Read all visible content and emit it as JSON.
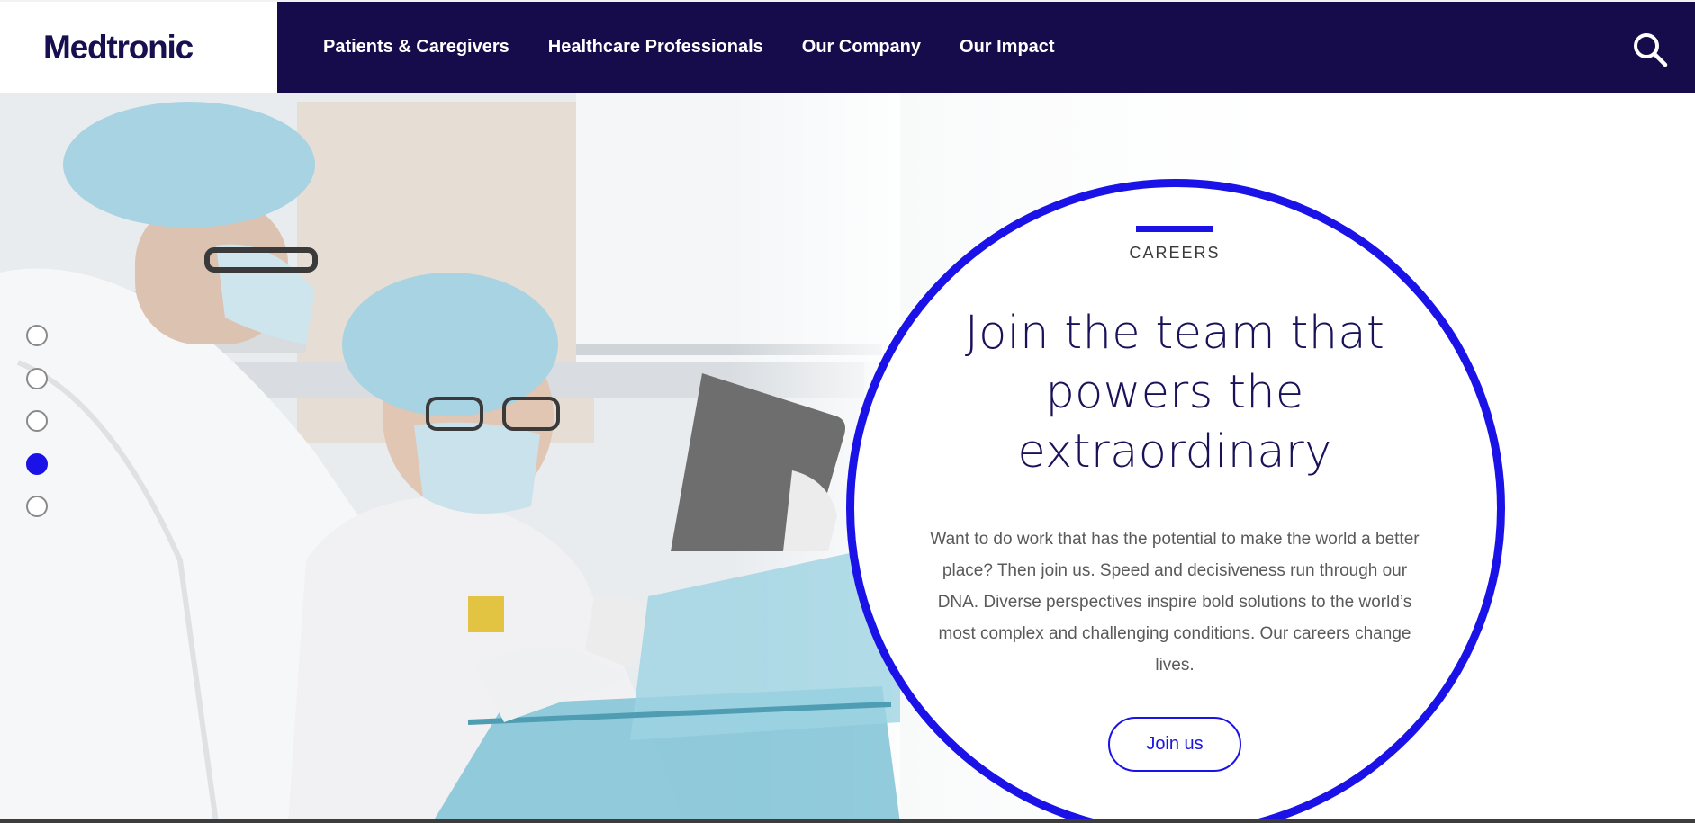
{
  "header": {
    "logo": "Medtronic",
    "nav": [
      {
        "label": "Patients & Caregivers"
      },
      {
        "label": "Healthcare Professionals"
      },
      {
        "label": "Our Company"
      },
      {
        "label": "Our Impact"
      }
    ],
    "search_icon": "search-icon"
  },
  "hero": {
    "eyebrow": "CAREERS",
    "headline_lines": [
      "Join the team that",
      "powers the",
      "extraordinary"
    ],
    "body": "Want to do work that has the potential to make the world a better place? Then join us. Speed and decisiveness run through our DNA. Diverse perspectives inspire bold solutions to the world’s most complex and challenging conditions. Our careers change lives.",
    "cta": "Join us",
    "carousel": {
      "slide_count": 5,
      "active_index": 4
    }
  },
  "colors": {
    "nav_background": "#170c4b",
    "brand_blue": "#1a12e6",
    "headline": "#1a1259"
  }
}
